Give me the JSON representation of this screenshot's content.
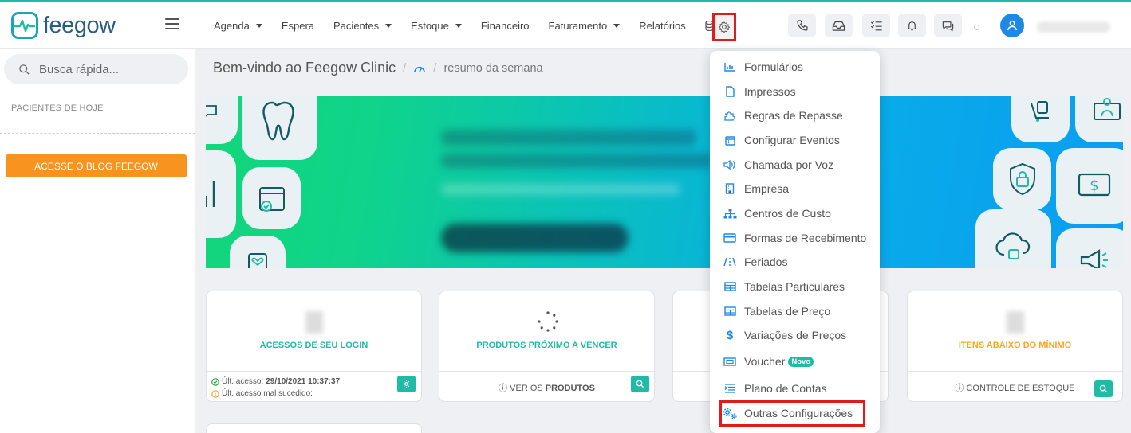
{
  "app": {
    "logo_text": "feegow"
  },
  "nav": {
    "items": [
      {
        "label": "Agenda",
        "has_caret": true
      },
      {
        "label": "Espera",
        "has_caret": false
      },
      {
        "label": "Pacientes",
        "has_caret": true
      },
      {
        "label": "Estoque",
        "has_caret": true
      },
      {
        "label": "Financeiro",
        "has_caret": false
      },
      {
        "label": "Faturamento",
        "has_caret": true
      },
      {
        "label": "Relatórios",
        "has_caret": false
      }
    ],
    "db_icon": "database-icon",
    "settings_icon": "gear-icon"
  },
  "header_icons": [
    "phone-icon",
    "inbox-icon",
    "checklist-icon",
    "bell-icon",
    "chat-icon"
  ],
  "sidebar": {
    "search_placeholder": "Busca rápida...",
    "heading": "PACIENTES DE HOJE",
    "blog_button": "ACESSE O BLOG FEEGOW"
  },
  "breadcrumb": {
    "title": "Bem-vindo ao Feegow Clinic",
    "separator": "/",
    "current": "resumo da semana"
  },
  "cards": [
    {
      "title": "ACESSOS DE SEU LOGIN",
      "title_color": "#1fbba6",
      "last_access_label": "Últ. acesso:",
      "last_access_value": "29/10/2021 10:37:37",
      "failed_label": "Últ. acesso mal sucedido:"
    },
    {
      "title": "PRODUTOS PRÓXIMO A VENCER",
      "title_color": "#1fbba6",
      "link_prefix": "VER OS",
      "link_strong": "PRODUTOS"
    },
    {
      "title": "",
      "title_color": "#1fbba6"
    },
    {
      "title": "ITENS ABAIXO DO MÍNIMO",
      "title_color": "#f7a81e",
      "link": "CONTROLE DE ESTOQUE"
    }
  ],
  "settings_menu": {
    "items": [
      {
        "label": "Formulários",
        "icon": "chart-icon"
      },
      {
        "label": "Impressos",
        "icon": "document-icon"
      },
      {
        "label": "Regras de Repasse",
        "icon": "puzzle-icon"
      },
      {
        "label": "Configurar Eventos",
        "icon": "calendar-icon"
      },
      {
        "label": "Chamada por Voz",
        "icon": "volume-icon"
      },
      {
        "label": "Empresa",
        "icon": "building-icon"
      },
      {
        "label": "Centros de Custo",
        "icon": "sitemap-icon"
      },
      {
        "label": "Formas de Recebimento",
        "icon": "credit-card-icon"
      },
      {
        "label": "Feriados",
        "icon": "road-icon"
      },
      {
        "label": "Tabelas Particulares",
        "icon": "table-icon"
      },
      {
        "label": "Tabelas de Preço",
        "icon": "table-icon"
      },
      {
        "label": "Variações de Preços",
        "icon": "dollar-icon"
      },
      {
        "label": "Voucher",
        "icon": "ticket-icon",
        "badge": "Novo"
      },
      {
        "label": "Plano de Contas",
        "icon": "list-indent-icon"
      },
      {
        "label": "Outras Configurações",
        "icon": "gears-icon"
      }
    ]
  },
  "colors": {
    "accent": "#1fbba6",
    "brand_dark": "#2a5d86",
    "orange": "#f7931e",
    "highlight": "#e11b1b"
  }
}
